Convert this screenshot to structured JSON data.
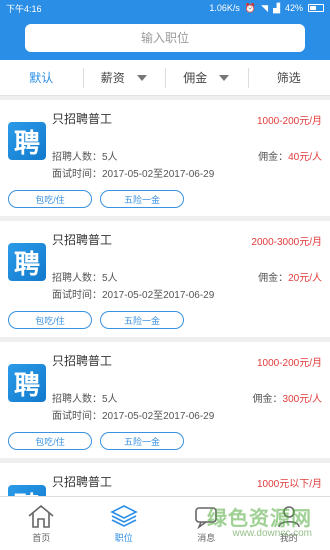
{
  "status_bar": {
    "time": "下午4:16",
    "speed": "1.06K/s",
    "battery": "42%"
  },
  "search": {
    "placeholder": "输入职位"
  },
  "filters": [
    "默认",
    "薪资",
    "佣金",
    "筛选"
  ],
  "labels": {
    "count_prefix": "招聘人数：",
    "date_prefix": "面试时间：",
    "commission_prefix": "佣金："
  },
  "jobs": [
    {
      "logo_char": "聘",
      "title": "只招聘普工",
      "salary": "1000-200元/月",
      "count": "5人",
      "commission": "40元/人",
      "date": "2017-05-02至2017-06-29",
      "tags": [
        "包吃/住",
        "五险一金"
      ]
    },
    {
      "logo_char": "聘",
      "title": "只招聘普工",
      "salary": "2000-3000元/月",
      "count": "5人",
      "commission": "20元/人",
      "date": "2017-05-02至2017-06-29",
      "tags": [
        "包吃/住",
        "五险一金"
      ]
    },
    {
      "logo_char": "聘",
      "title": "只招聘普工",
      "salary": "1000-200元/月",
      "count": "5人",
      "commission": "300元/人",
      "date": "2017-05-02至2017-06-29",
      "tags": [
        "包吃/住",
        "五险一金"
      ]
    },
    {
      "logo_char": "聘",
      "title": "只招聘普工",
      "salary": "1000元以下/月"
    }
  ],
  "tabs": [
    "首页",
    "职位",
    "消息",
    "我的"
  ],
  "watermark": {
    "main": "绿色资源网",
    "url": "www.downcc.com"
  },
  "colors": {
    "primary": "#2a8ee6",
    "price": "#e23b3b"
  }
}
